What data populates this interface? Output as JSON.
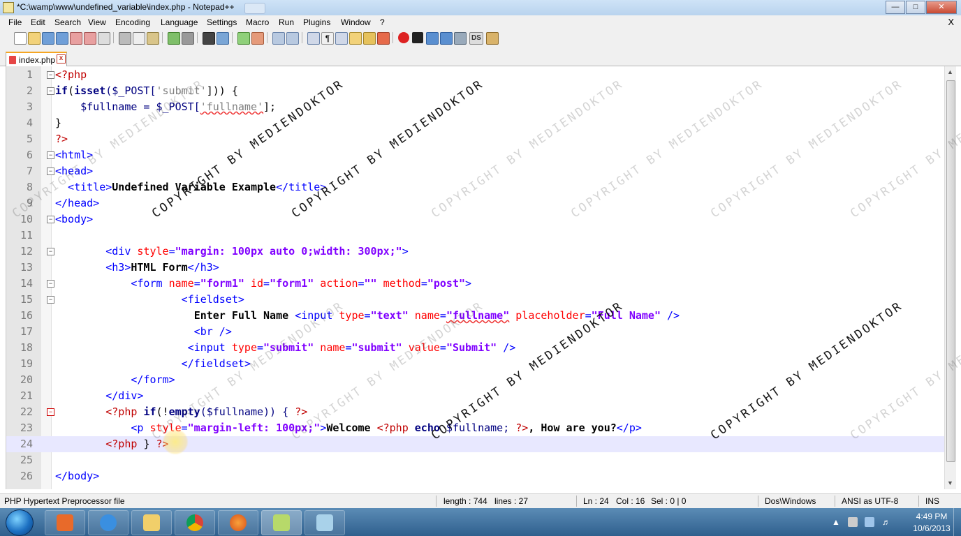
{
  "window": {
    "title": "*C:\\wamp\\www\\undefined_variable\\index.php - Notepad++"
  },
  "menu": [
    "File",
    "Edit",
    "Search",
    "View",
    "Encoding",
    "Language",
    "Settings",
    "Macro",
    "Run",
    "Plugins",
    "Window",
    "?"
  ],
  "menu_close": "X",
  "toolbar": {
    "ds_label": "DS"
  },
  "tab": {
    "label": "index.php",
    "close": "x"
  },
  "lines": [
    {
      "n": "1"
    },
    {
      "n": "2"
    },
    {
      "n": "3"
    },
    {
      "n": "4"
    },
    {
      "n": "5"
    },
    {
      "n": "6"
    },
    {
      "n": "7"
    },
    {
      "n": "8"
    },
    {
      "n": "9"
    },
    {
      "n": "10"
    },
    {
      "n": "11"
    },
    {
      "n": "12"
    },
    {
      "n": "13"
    },
    {
      "n": "14"
    },
    {
      "n": "15"
    },
    {
      "n": "16"
    },
    {
      "n": "17"
    },
    {
      "n": "18"
    },
    {
      "n": "19"
    },
    {
      "n": "20"
    },
    {
      "n": "21"
    },
    {
      "n": "22"
    },
    {
      "n": "23"
    },
    {
      "n": "24"
    },
    {
      "n": "25"
    },
    {
      "n": "26"
    }
  ],
  "code": {
    "l1": "<?php",
    "l2a": "if",
    "l2b": "(",
    "l2c": "isset",
    "l2d": "($_POST[",
    "l2e": "'submit'",
    "l2f": "])) {",
    "l3a": "    $fullname = $_POST[",
    "l3b": "'fullname'",
    "l3c": "];",
    "l4": "}",
    "l5": "?>",
    "l6": "<html>",
    "l7": "<head>",
    "l8a": "  <title>",
    "l8b": "Undefined Variable Example",
    "l8c": "</title>",
    "l9": "</head>",
    "l10": "<body>",
    "l12a": "        <div ",
    "l12b": "style",
    "l12c": "=",
    "l12d": "\"margin: 100px auto 0;width: 300px;\"",
    "l12e": ">",
    "l13a": "        <h3>",
    "l13b": "HTML Form",
    "l13c": "</h3>",
    "l14a": "            <form ",
    "l14b": "name",
    "l14c": "=",
    "l14d": "\"form1\"",
    "l14e": " id",
    "l14f": "=",
    "l14g": "\"form1\"",
    "l14h": " action",
    "l14i": "=",
    "l14j": "\"\"",
    "l14k": " method",
    "l14l": "=",
    "l14m": "\"post\"",
    "l14n": ">",
    "l15": "                    <fieldset>",
    "l16a": "                      ",
    "l16b": "Enter Full Name ",
    "l16c": "<input ",
    "l16d": "type",
    "l16e": "=",
    "l16f": "\"text\"",
    "l16g": " name",
    "l16h": "=",
    "l16i": "\"fullname\"",
    "l16j": " placeholder",
    "l16k": "=",
    "l16l": "\"Full Name\"",
    "l16m": " />",
    "l17": "                      <br />",
    "l18a": "                     <input ",
    "l18b": "type",
    "l18c": "=",
    "l18d": "\"submit\"",
    "l18e": " name",
    "l18f": "=",
    "l18g": "\"submit\"",
    "l18h": " value",
    "l18i": "=",
    "l18j": "\"Submit\"",
    "l18k": " />",
    "l19": "                    </fieldset>",
    "l20": "            </form>",
    "l21": "        </div>",
    "l22a": "        <?php ",
    "l22b": "if",
    "l22c": "(!",
    "l22d": "empty",
    "l22e": "($fullname)) { ",
    "l22f": "?>",
    "l23a": "            <p ",
    "l23b": "style",
    "l23c": "=",
    "l23d": "\"margin-left: 100px;\"",
    "l23e": ">",
    "l23f": "Welcome ",
    "l23g": "<?php ",
    "l23h": "echo",
    "l23i": " $fullname; ",
    "l23j": "?>",
    "l23k": ", How are you?",
    "l23l": "</p>",
    "l24a": "        <?php ",
    "l24b": "} ",
    "l24c": "?>",
    "l26": "</body>"
  },
  "status": {
    "filetype": "PHP Hypertext Preprocessor file",
    "length": "length : 744",
    "lines": "lines : 27",
    "ln": "Ln : 24",
    "col": "Col : 16",
    "sel": "Sel : 0 | 0",
    "eol": "Dos\\Windows",
    "encoding": "ANSI as UTF-8",
    "mode": "INS"
  },
  "tray": {
    "time": "4:49 PM",
    "date": "10/6/2013"
  },
  "watermark": "COPYRIGHT BY MEDIENDOKTOR",
  "colors": {
    "php_tag": "#c00000",
    "keyword": "#000080",
    "html_tag": "#0000ff",
    "attr": "#ff0000",
    "attr_value": "#8000ff",
    "tab_accent": "#f5a623"
  }
}
